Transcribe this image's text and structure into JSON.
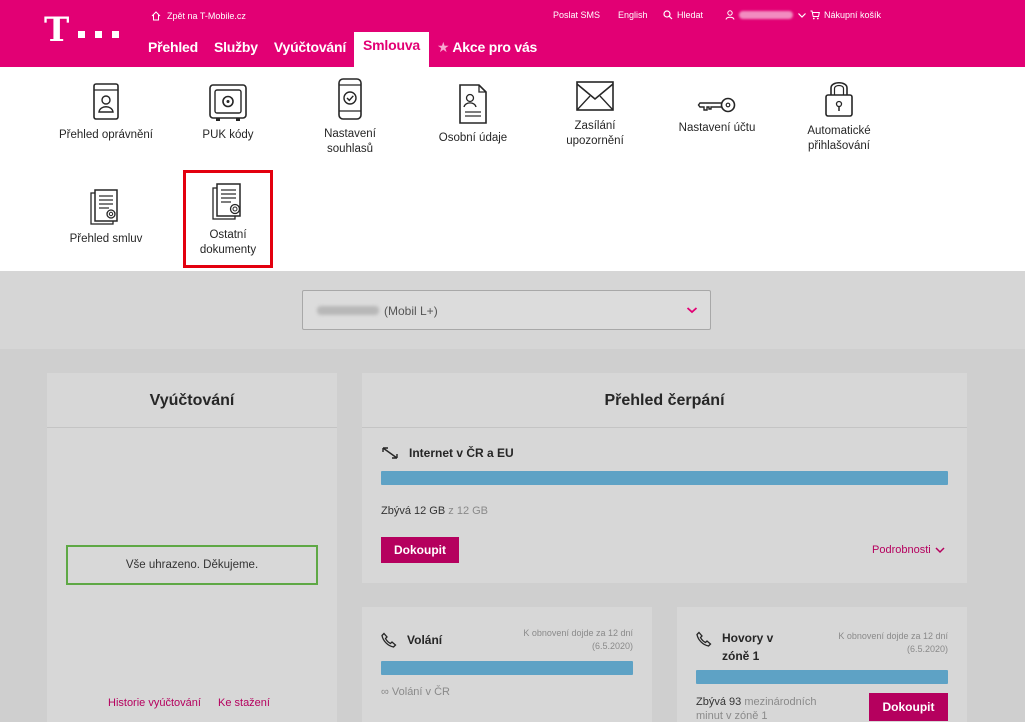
{
  "header": {
    "back_link": "Zpět na T-Mobile.cz",
    "send_sms": "Poslat SMS",
    "language": "English",
    "search": "Hledat",
    "cart": "Nákupní košík",
    "logo_text": "T",
    "brand_color": "#e20074"
  },
  "nav": {
    "items": [
      {
        "label": "Přehled"
      },
      {
        "label": "Služby"
      },
      {
        "label": "Vyúčtování"
      },
      {
        "label": "Smlouva"
      },
      {
        "label": "Akce pro vás"
      }
    ],
    "active": "Smlouva"
  },
  "submenu": {
    "items": [
      {
        "label": "Přehled oprávnění",
        "icon": "id-book-icon"
      },
      {
        "label": "PUK kódy",
        "icon": "safe-icon"
      },
      {
        "label": "Nastavení souhlasů",
        "icon": "phone-check-icon"
      },
      {
        "label": "Osobní údaje",
        "icon": "personal-document-icon"
      },
      {
        "label": "Zasílání upozornění",
        "icon": "envelope-icon"
      },
      {
        "label": "Nastavení účtu",
        "icon": "key-icon"
      },
      {
        "label": "Automatické přihlašování",
        "icon": "padlock-icon"
      },
      {
        "label": "Přehled smluv",
        "icon": "contract-icon"
      },
      {
        "label": "Ostatní dokumenty",
        "icon": "documents-certificate-icon"
      }
    ],
    "highlighted": "Ostatní dokumenty"
  },
  "selector": {
    "value": "(Mobil L+)"
  },
  "billing": {
    "title": "Vyúčtování",
    "status": "Vše uhrazeno. Děkujeme.",
    "history_link": "Historie vyúčtování",
    "download_link": "Ke stažení"
  },
  "usage": {
    "title": "Přehled čerpání",
    "internet": {
      "label": "Internet v ČR a EU",
      "remaining": "Zbývá 12 GB",
      "total": "z 12 GB",
      "buy": "Dokoupit",
      "details": "Podrobnosti",
      "remaining_fraction": 1.0
    },
    "calls": {
      "label": "Volání",
      "renew_line1": "K obnovení dojde za 12 dní",
      "renew_line2": "(6.5.2020)",
      "remaining": "∞ Volání v ČR",
      "remaining_fraction": 1.0
    },
    "zone1": {
      "label_line1": "Hovory v",
      "label_line2": "zóně 1",
      "renew_line1": "K obnovení dojde za 12 dní",
      "renew_line2": "(6.5.2020)",
      "remaining_bold": "Zbývá 93",
      "remaining_rest": "mezinárodních",
      "remaining_line2": "minut v zóně 1",
      "buy": "Dokoupit",
      "remaining_fraction": 1.0
    }
  },
  "colors": {
    "magenta": "#e20074",
    "button": "#b5005e",
    "bar": "#5ea2c5",
    "success_border": "#5ea845",
    "highlight_border": "#e3000f"
  }
}
